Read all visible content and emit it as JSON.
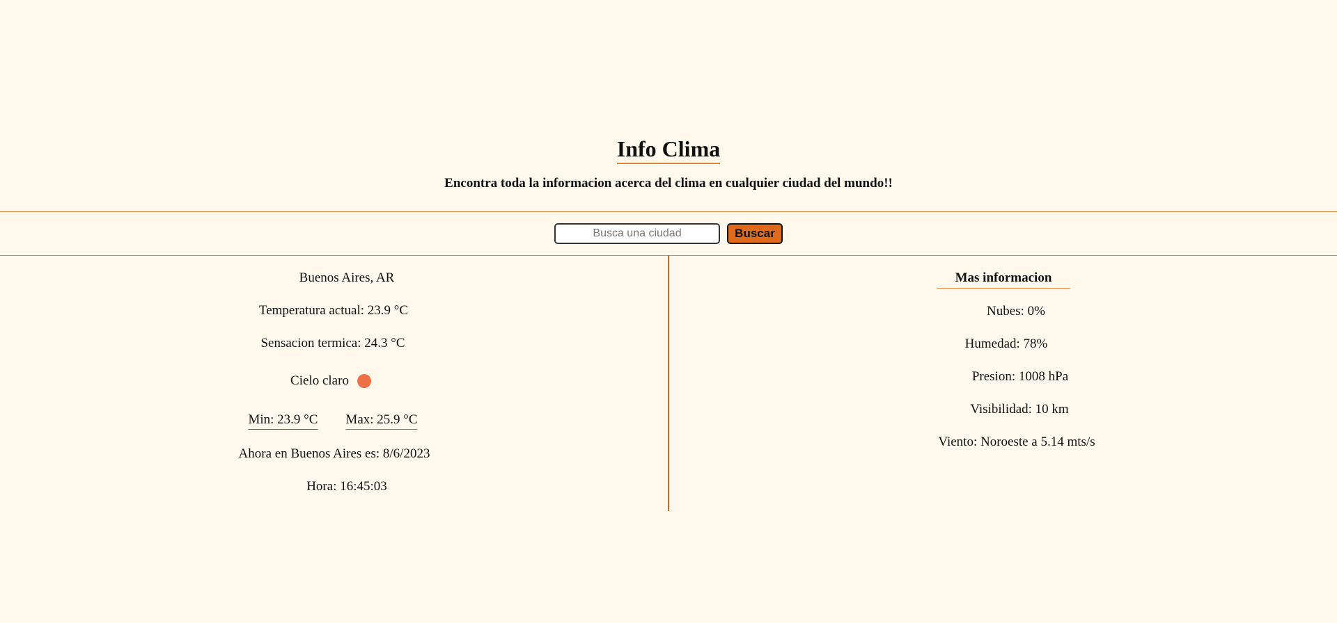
{
  "header": {
    "title": "Info Clima",
    "subtitle": "Encontra toda la informacion acerca del clima en cualquier ciudad del mundo!!"
  },
  "search": {
    "placeholder": "Busca una ciudad",
    "value": "",
    "button_label": "Buscar"
  },
  "current": {
    "city": "Buenos Aires, AR",
    "temperature": "Temperatura actual: 23.9 °C",
    "feels_like": "Sensacion termica: 24.3 °C",
    "sky": "Cielo claro",
    "min": "Min: 23.9 °C",
    "max": "Max: 25.9 °C",
    "now": "Ahora en Buenos Aires es: 8/6/2023",
    "hour": "Hora: 16:45:03"
  },
  "more_info": {
    "title": "Mas informacion",
    "clouds": "Nubes: 0%",
    "humidity": "Humedad: 78%",
    "pressure": "Presion: 1008 hPa",
    "visibility": "Visibilidad: 10 km",
    "wind": "Viento: Noroeste a 5.14 mts/s"
  },
  "colors": {
    "background": "#fff8ec",
    "accent": "#e0883a",
    "button": "#e06a1c",
    "sky_icon": "#ee7045",
    "min_underline": "#4a4ad0",
    "max_underline": "#e0484a"
  },
  "icons": {
    "sky": "weather-dot-icon"
  }
}
